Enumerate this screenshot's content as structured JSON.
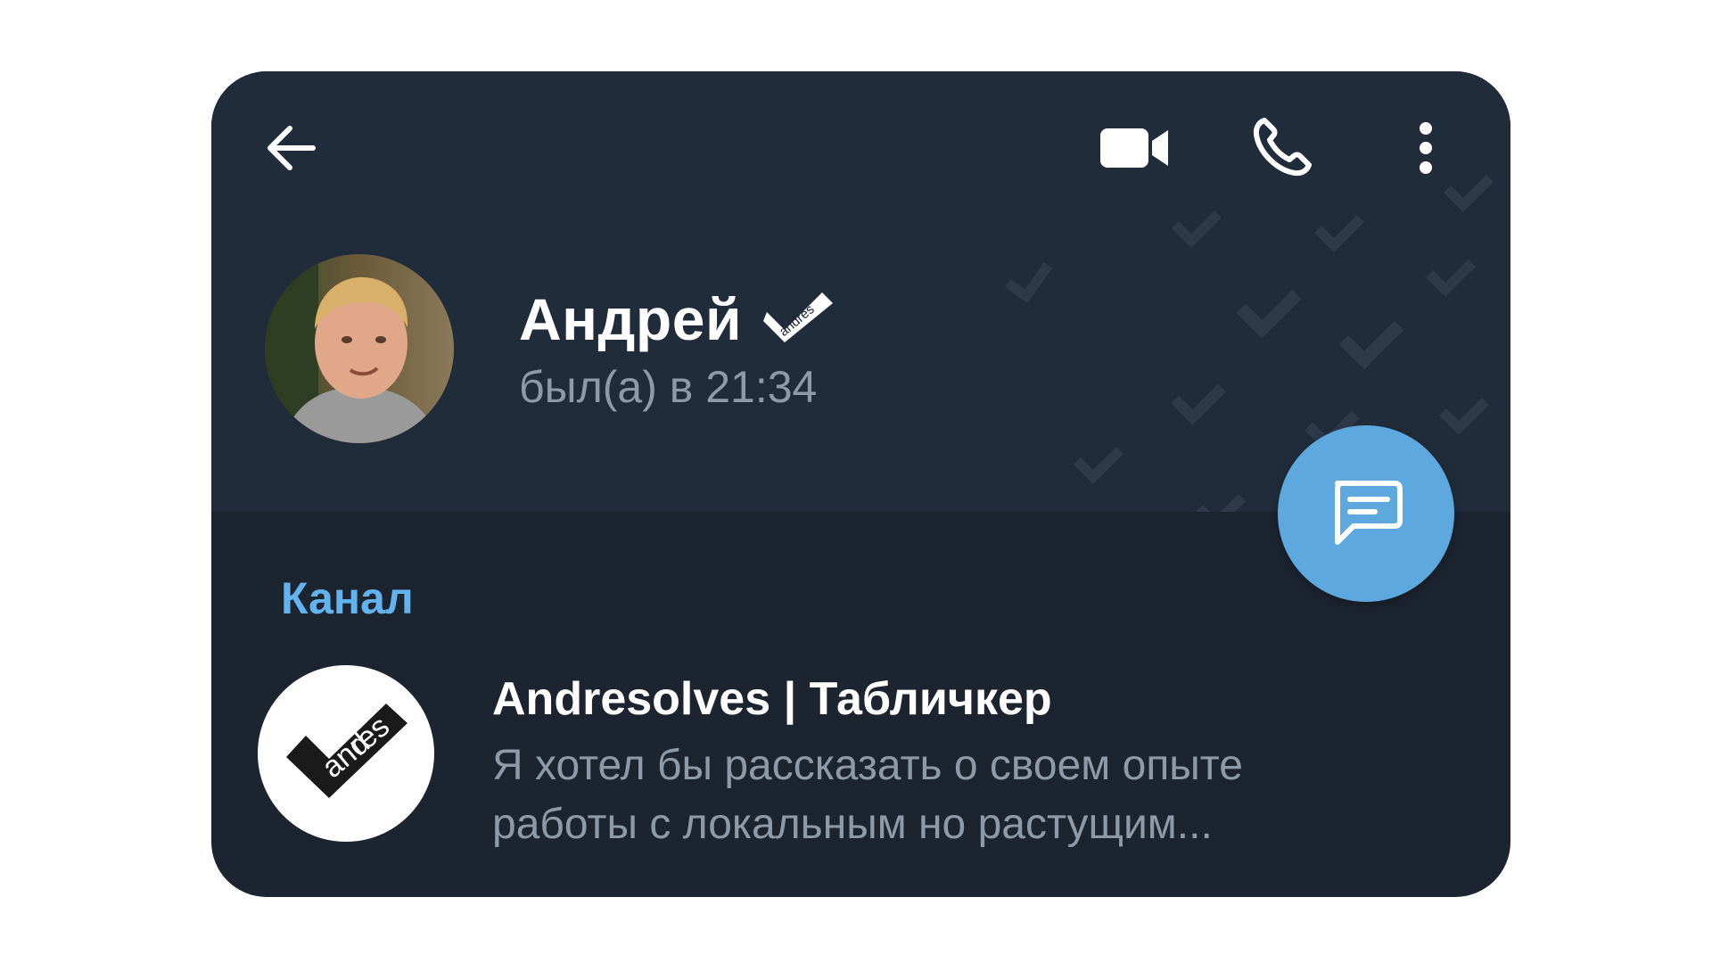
{
  "header": {
    "back_icon": "arrow-left-icon",
    "video_icon": "video-camera-icon",
    "call_icon": "phone-icon",
    "more_icon": "more-vertical-icon"
  },
  "profile": {
    "name": "Андрей",
    "status": "был(а) в 21:34",
    "badge_text": "andres"
  },
  "fab": {
    "icon": "message-icon"
  },
  "channel": {
    "section_label": "Канал",
    "title": "Andresolves | Табличкер",
    "description_line1": "Я хотел бы рассказать о своем опыте",
    "description_line2": "работы с локальным но растущим...",
    "logo_text": "andres"
  },
  "colors": {
    "card_bg": "#1c2430",
    "header_bg": "#212c3a",
    "accent": "#62b2ee",
    "fab": "#5ea8e0",
    "muted_text": "#8e9aa8"
  }
}
